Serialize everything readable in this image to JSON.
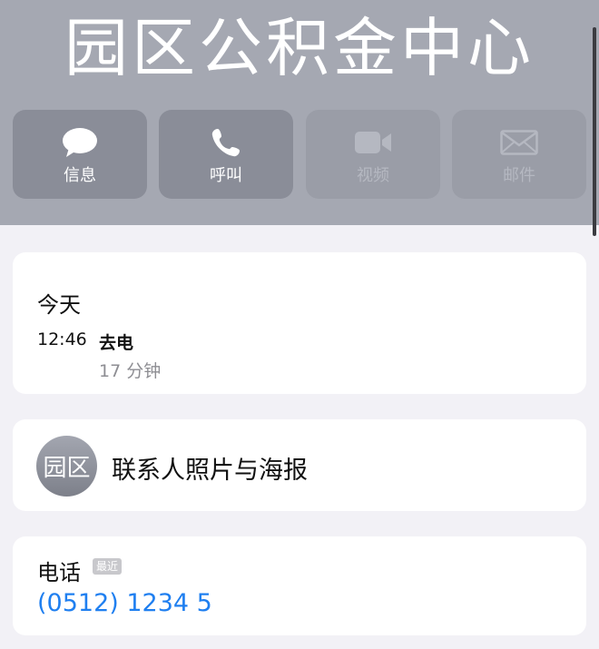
{
  "contact": {
    "name": "园区公积金中心"
  },
  "actions": [
    {
      "label": "信息",
      "icon": "message-bubble-icon",
      "enabled": true
    },
    {
      "label": "呼叫",
      "icon": "phone-icon",
      "enabled": true
    },
    {
      "label": "视频",
      "icon": "video-camera-icon",
      "enabled": false
    },
    {
      "label": "邮件",
      "icon": "mail-icon",
      "enabled": false
    }
  ],
  "recent_calls": {
    "title": "今天",
    "entry": {
      "time": "12:46",
      "type": "去电",
      "duration": "17 分钟"
    }
  },
  "poster": {
    "avatar_text": "园区",
    "label": "联系人照片与海报"
  },
  "phone": {
    "label": "电话",
    "badge": "最近",
    "number": "(0512) 1234 5"
  },
  "colors": {
    "header_bg": "#a5a8b2",
    "link_blue": "#1f7ff0",
    "page_bg": "#f2f1f6"
  }
}
